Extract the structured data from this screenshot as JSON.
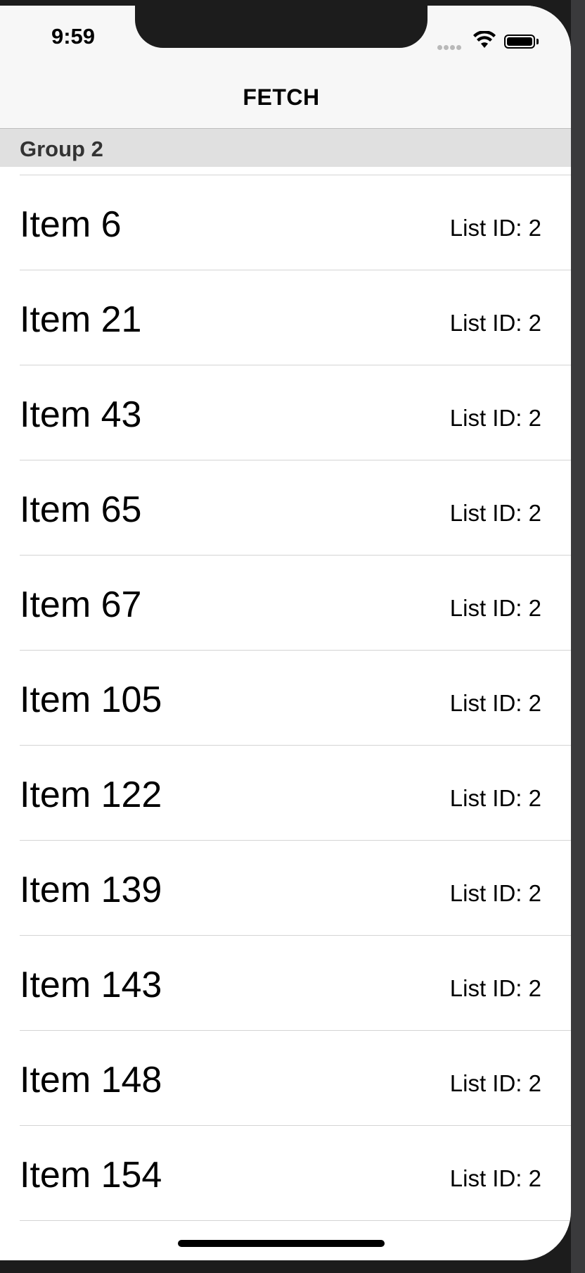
{
  "status_bar": {
    "time": "9:59",
    "icons": [
      "signal-dots-icon",
      "wifi-icon",
      "battery-icon"
    ]
  },
  "nav": {
    "title": "FETCH"
  },
  "section": {
    "title": "Group 2"
  },
  "rows": [
    {
      "name": "Item 6",
      "detail": "List ID: 2"
    },
    {
      "name": "Item 21",
      "detail": "List ID: 2"
    },
    {
      "name": "Item 43",
      "detail": "List ID: 2"
    },
    {
      "name": "Item 65",
      "detail": "List ID: 2"
    },
    {
      "name": "Item 67",
      "detail": "List ID: 2"
    },
    {
      "name": "Item 105",
      "detail": "List ID: 2"
    },
    {
      "name": "Item 122",
      "detail": "List ID: 2"
    },
    {
      "name": "Item 139",
      "detail": "List ID: 2"
    },
    {
      "name": "Item 143",
      "detail": "List ID: 2"
    },
    {
      "name": "Item 148",
      "detail": "List ID: 2"
    },
    {
      "name": "Item 154",
      "detail": "List ID: 2"
    }
  ],
  "colors": {
    "navbar_bg": "#f7f7f7",
    "section_header_bg": "#e0e0e0",
    "separator": "#d4d4d4",
    "device_frame": "#1c1c1c"
  }
}
